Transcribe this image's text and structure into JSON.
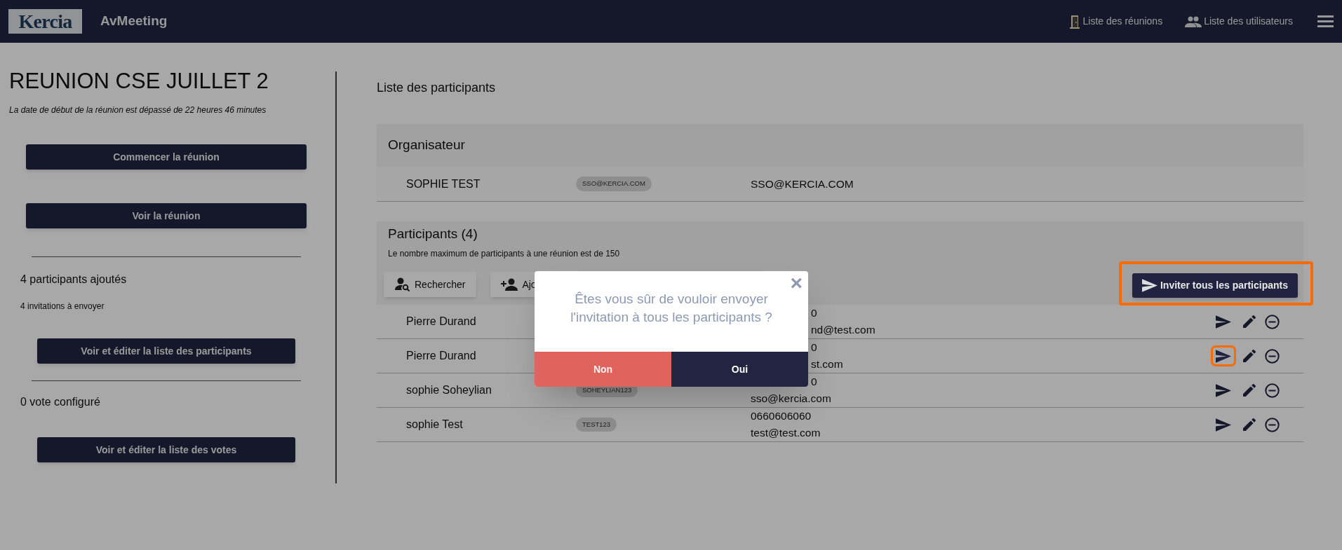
{
  "header": {
    "logo_text": "Kercia",
    "app_name": "AvMeeting",
    "nav": [
      {
        "label": "Liste des réunions"
      },
      {
        "label": "Liste des utilisateurs"
      }
    ]
  },
  "meeting": {
    "title": "REUNION CSE JUILLET 2",
    "notice": "La date de début de la réunion est dépassé de 22 heures 46 minutes",
    "buttons": [
      "Commencer la réunion",
      "Voir la réunion"
    ],
    "participants_count": "4 participants ajoutés",
    "invitations": "4 invitations à envoyer",
    "participants_button": "Voir et éditer la liste des participants",
    "votes_count": "0 vote configuré",
    "votes_button": "Voir et éditer la liste des votes"
  },
  "content": {
    "title": "Liste des participants",
    "organizer": {
      "heading": "Organisateur",
      "name": "SOPHIE TEST",
      "badge": "SSO@KERCIA.COM",
      "email": "SSO@KERCIA.COM"
    },
    "participants": {
      "heading": "Participants (4)",
      "note": "Le nombre maximum de participants à une réunion est de 150",
      "tools": [
        {
          "label": "Rechercher",
          "cut": false
        },
        {
          "label": "Ajo",
          "cut": true
        }
      ],
      "invite_button": {
        "label": "Inviter tous les participants",
        "highlighted": true
      },
      "rows": [
        {
          "name": "Pierre Durand",
          "contact": [
            {
              "text": "0",
              "kind": "cut"
            },
            {
              "text": "nd@test.com",
              "kind": "cut"
            }
          ],
          "send_highlighted": false
        },
        {
          "name": "Pierre Durand",
          "contact": [
            {
              "text": "0",
              "kind": "cut"
            },
            {
              "text": "st.com",
              "kind": "cut"
            }
          ],
          "send_highlighted": true
        },
        {
          "name": "sophie Soheylian",
          "badge": "SOHEYLIAN123",
          "contact": [
            {
              "text": "0",
              "kind": "cut"
            },
            {
              "text": "sso@kercia.com",
              "kind": "full"
            }
          ],
          "send_highlighted": false
        },
        {
          "name": "sophie Test",
          "badge": "TEST123",
          "contact": [
            {
              "text": "0660606060",
              "kind": "full"
            },
            {
              "text": "test@test.com",
              "kind": "full"
            }
          ],
          "send_highlighted": false
        }
      ]
    }
  },
  "dialog": {
    "close": "×",
    "message": "Êtes vous sûr de vouloir envoyer l'invitation à tous les participants ?",
    "buttons": [
      {
        "label": "Non",
        "kind": "cancel"
      },
      {
        "label": "Oui",
        "kind": "confirm"
      }
    ]
  }
}
